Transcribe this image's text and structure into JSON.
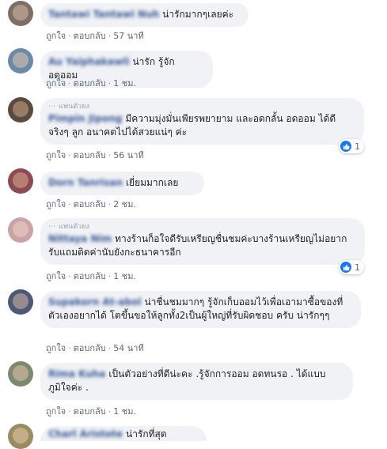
{
  "actions": {
    "like": "ถูกใจ",
    "reply": "ตอบกลับ"
  },
  "comments": [
    {
      "name": "Tantawi Tantawi Nuh",
      "text": "น่ารักมากๆเลยค่ะ",
      "time": "57 นาที"
    },
    {
      "name": "Au Yaiphakawli",
      "text": "น่ารัก รู้จักอดออม",
      "time": "1 ชม."
    },
    {
      "meta": "แฟนตัวยง",
      "name": "Pimpin Jipong",
      "text": "มีความมุ่งมั่นเพียรพยายาม และอดกลั้น อดออม ได้ดีจริงๆ ลูก อนาคตไปได้สวยแน่ๆ ค่ะ",
      "time": "56 นาที",
      "reaction_count": "1"
    },
    {
      "name": "Dorn Tanrisan",
      "text": "เยี่ยมมากเลย",
      "time": "2 ชม."
    },
    {
      "meta": "แฟนตัวยง",
      "name": "Nittaya Nim",
      "text": "ทางร้านก็อใจดีรับเหรียญชื่นชมค่ะบางร้านเหรียญไม่อยากรับแถมติดค่านับยังกะธนาคารอีก",
      "time": "1 ชม.",
      "reaction_count": "1"
    },
    {
      "name": "Supakorn At-abol",
      "text": "น่าชื่นชมมากๆ รู้จักเก็บออมไว้เพื่อเอามาซื้อของที่ตัวเองอยากได้ โตขึ้นขอให้ลูกทั้ง2เป็นผู้ใหญ่ที่รับผิดชอบ ครับ น่ารักๆๆ",
      "time": "54 นาที"
    },
    {
      "name": "Rima Kuha",
      "text": "เป็นตัวอย่างที่ดีน่ะคะ .รู้จักการออม อดทนรอ . ได้แบบภูมิใจค่ะ .",
      "time": "1 ชม."
    },
    {
      "name": "Charl Aristote",
      "text": "น่ารักที่สุด"
    }
  ]
}
